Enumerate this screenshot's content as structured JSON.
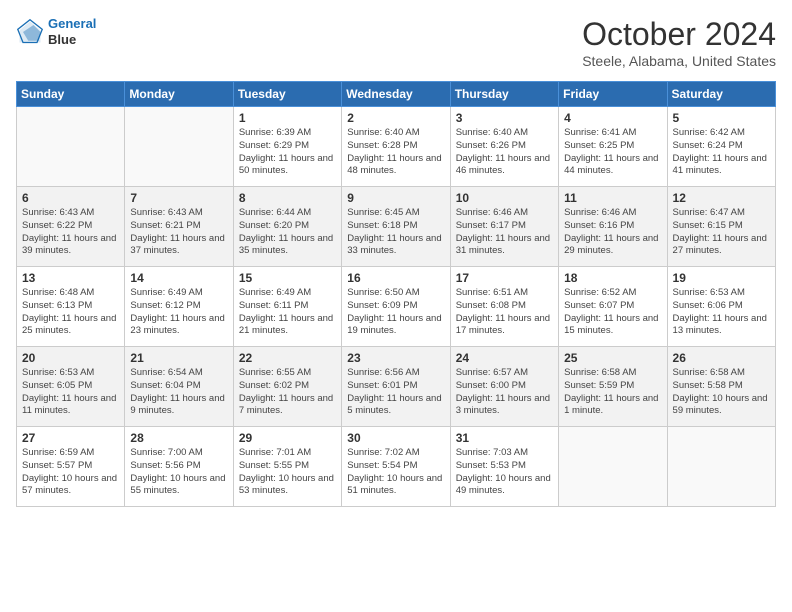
{
  "header": {
    "logo_line1": "General",
    "logo_line2": "Blue",
    "month_title": "October 2024",
    "location": "Steele, Alabama, United States"
  },
  "days_of_week": [
    "Sunday",
    "Monday",
    "Tuesday",
    "Wednesday",
    "Thursday",
    "Friday",
    "Saturday"
  ],
  "weeks": [
    [
      {
        "day": "",
        "content": ""
      },
      {
        "day": "",
        "content": ""
      },
      {
        "day": "1",
        "content": "Sunrise: 6:39 AM\nSunset: 6:29 PM\nDaylight: 11 hours and 50 minutes."
      },
      {
        "day": "2",
        "content": "Sunrise: 6:40 AM\nSunset: 6:28 PM\nDaylight: 11 hours and 48 minutes."
      },
      {
        "day": "3",
        "content": "Sunrise: 6:40 AM\nSunset: 6:26 PM\nDaylight: 11 hours and 46 minutes."
      },
      {
        "day": "4",
        "content": "Sunrise: 6:41 AM\nSunset: 6:25 PM\nDaylight: 11 hours and 44 minutes."
      },
      {
        "day": "5",
        "content": "Sunrise: 6:42 AM\nSunset: 6:24 PM\nDaylight: 11 hours and 41 minutes."
      }
    ],
    [
      {
        "day": "6",
        "content": "Sunrise: 6:43 AM\nSunset: 6:22 PM\nDaylight: 11 hours and 39 minutes."
      },
      {
        "day": "7",
        "content": "Sunrise: 6:43 AM\nSunset: 6:21 PM\nDaylight: 11 hours and 37 minutes."
      },
      {
        "day": "8",
        "content": "Sunrise: 6:44 AM\nSunset: 6:20 PM\nDaylight: 11 hours and 35 minutes."
      },
      {
        "day": "9",
        "content": "Sunrise: 6:45 AM\nSunset: 6:18 PM\nDaylight: 11 hours and 33 minutes."
      },
      {
        "day": "10",
        "content": "Sunrise: 6:46 AM\nSunset: 6:17 PM\nDaylight: 11 hours and 31 minutes."
      },
      {
        "day": "11",
        "content": "Sunrise: 6:46 AM\nSunset: 6:16 PM\nDaylight: 11 hours and 29 minutes."
      },
      {
        "day": "12",
        "content": "Sunrise: 6:47 AM\nSunset: 6:15 PM\nDaylight: 11 hours and 27 minutes."
      }
    ],
    [
      {
        "day": "13",
        "content": "Sunrise: 6:48 AM\nSunset: 6:13 PM\nDaylight: 11 hours and 25 minutes."
      },
      {
        "day": "14",
        "content": "Sunrise: 6:49 AM\nSunset: 6:12 PM\nDaylight: 11 hours and 23 minutes."
      },
      {
        "day": "15",
        "content": "Sunrise: 6:49 AM\nSunset: 6:11 PM\nDaylight: 11 hours and 21 minutes."
      },
      {
        "day": "16",
        "content": "Sunrise: 6:50 AM\nSunset: 6:09 PM\nDaylight: 11 hours and 19 minutes."
      },
      {
        "day": "17",
        "content": "Sunrise: 6:51 AM\nSunset: 6:08 PM\nDaylight: 11 hours and 17 minutes."
      },
      {
        "day": "18",
        "content": "Sunrise: 6:52 AM\nSunset: 6:07 PM\nDaylight: 11 hours and 15 minutes."
      },
      {
        "day": "19",
        "content": "Sunrise: 6:53 AM\nSunset: 6:06 PM\nDaylight: 11 hours and 13 minutes."
      }
    ],
    [
      {
        "day": "20",
        "content": "Sunrise: 6:53 AM\nSunset: 6:05 PM\nDaylight: 11 hours and 11 minutes."
      },
      {
        "day": "21",
        "content": "Sunrise: 6:54 AM\nSunset: 6:04 PM\nDaylight: 11 hours and 9 minutes."
      },
      {
        "day": "22",
        "content": "Sunrise: 6:55 AM\nSunset: 6:02 PM\nDaylight: 11 hours and 7 minutes."
      },
      {
        "day": "23",
        "content": "Sunrise: 6:56 AM\nSunset: 6:01 PM\nDaylight: 11 hours and 5 minutes."
      },
      {
        "day": "24",
        "content": "Sunrise: 6:57 AM\nSunset: 6:00 PM\nDaylight: 11 hours and 3 minutes."
      },
      {
        "day": "25",
        "content": "Sunrise: 6:58 AM\nSunset: 5:59 PM\nDaylight: 11 hours and 1 minute."
      },
      {
        "day": "26",
        "content": "Sunrise: 6:58 AM\nSunset: 5:58 PM\nDaylight: 10 hours and 59 minutes."
      }
    ],
    [
      {
        "day": "27",
        "content": "Sunrise: 6:59 AM\nSunset: 5:57 PM\nDaylight: 10 hours and 57 minutes."
      },
      {
        "day": "28",
        "content": "Sunrise: 7:00 AM\nSunset: 5:56 PM\nDaylight: 10 hours and 55 minutes."
      },
      {
        "day": "29",
        "content": "Sunrise: 7:01 AM\nSunset: 5:55 PM\nDaylight: 10 hours and 53 minutes."
      },
      {
        "day": "30",
        "content": "Sunrise: 7:02 AM\nSunset: 5:54 PM\nDaylight: 10 hours and 51 minutes."
      },
      {
        "day": "31",
        "content": "Sunrise: 7:03 AM\nSunset: 5:53 PM\nDaylight: 10 hours and 49 minutes."
      },
      {
        "day": "",
        "content": ""
      },
      {
        "day": "",
        "content": ""
      }
    ]
  ]
}
